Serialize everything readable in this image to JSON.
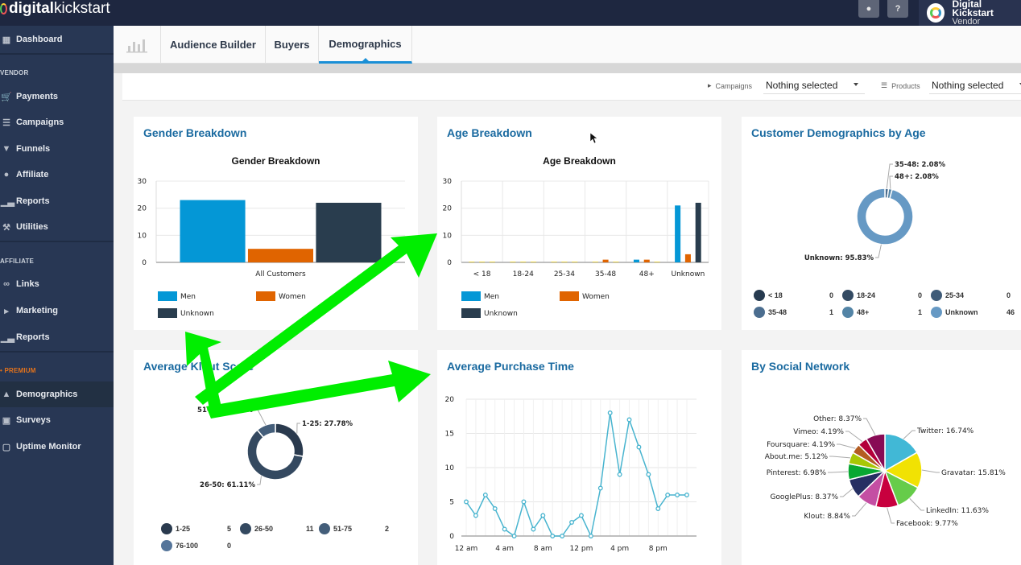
{
  "app": {
    "logo_bold": "digital",
    "logo_light": "kickstart",
    "account_name": "Digital Kickstart",
    "account_role": "Vendor",
    "user_btn_icon": "user-icon",
    "help_btn_label": "?"
  },
  "sidebar": {
    "dashboard": "Dashboard",
    "sections": [
      {
        "title": "VENDOR",
        "items": [
          {
            "label": "Payments",
            "icon": "cart-icon"
          },
          {
            "label": "Campaigns",
            "icon": "list-icon"
          },
          {
            "label": "Funnels",
            "icon": "funnel-icon"
          },
          {
            "label": "Affiliate",
            "icon": "user-icon"
          },
          {
            "label": "Reports",
            "icon": "bar-chart-icon"
          },
          {
            "label": "Utilities",
            "icon": "wrench-icon"
          }
        ]
      },
      {
        "title": "AFFILIATE",
        "items": [
          {
            "label": "Links",
            "icon": "link-icon"
          },
          {
            "label": "Marketing",
            "icon": "megaphone-icon"
          },
          {
            "label": "Reports",
            "icon": "bar-chart-icon"
          }
        ]
      },
      {
        "title": "PREMIUM",
        "items": [
          {
            "label": "Demographics",
            "icon": "area-chart-icon",
            "active": true
          },
          {
            "label": "Surveys",
            "icon": "document-icon"
          },
          {
            "label": "Uptime Monitor",
            "icon": "monitor-icon"
          }
        ]
      }
    ]
  },
  "tabs": [
    {
      "label": "Audience Builder"
    },
    {
      "label": "Buyers"
    },
    {
      "label": "Demographics",
      "active": true
    }
  ],
  "filters": {
    "campaigns_label": "Campaigns",
    "campaigns_value": "Nothing selected",
    "products_label": "Products",
    "products_value": "Nothing selected"
  },
  "cards": {
    "gender": {
      "title": "Gender Breakdown"
    },
    "age": {
      "title": "Age Breakdown"
    },
    "cust_age": {
      "title": "Customer Demographics by Age"
    },
    "klout": {
      "title": "Average Klout Score"
    },
    "purchase": {
      "title": "Average Purchase Time"
    },
    "social": {
      "title": "By Social Network"
    }
  },
  "chart_data": [
    {
      "id": "gender",
      "type": "bar",
      "title": "Gender Breakdown",
      "categories": [
        "All Customers"
      ],
      "series": [
        {
          "name": "Men",
          "values": [
            23
          ],
          "color": "#0497d6"
        },
        {
          "name": "Women",
          "values": [
            5
          ],
          "color": "#e06400"
        },
        {
          "name": "Unknown",
          "values": [
            22
          ],
          "color": "#293d4e"
        }
      ],
      "ylim": [
        0,
        30
      ],
      "yticks": [
        0,
        10,
        20,
        30
      ],
      "legend": "bottom-left"
    },
    {
      "id": "age",
      "type": "bar",
      "title": "Age Breakdown",
      "categories": [
        "< 18",
        "18-24",
        "25-34",
        "35-48",
        "48+",
        "Unknown"
      ],
      "series": [
        {
          "name": "Men",
          "values": [
            0,
            0,
            0,
            0,
            1,
            21
          ],
          "color": "#0497d6"
        },
        {
          "name": "Women",
          "values": [
            0,
            0,
            0,
            1,
            1,
            3
          ],
          "color": "#e06400"
        },
        {
          "name": "Unknown",
          "values": [
            0,
            0,
            0,
            0,
            0,
            22
          ],
          "color": "#293d4e"
        }
      ],
      "ylim": [
        0,
        30
      ],
      "yticks": [
        0,
        10,
        20,
        30
      ],
      "legend": "bottom-left"
    },
    {
      "id": "cust_age",
      "type": "pie",
      "donut": true,
      "slices": [
        {
          "label": "< 18",
          "value": 0,
          "color": "#263a4f"
        },
        {
          "label": "18-24",
          "value": 0,
          "color": "#344b63"
        },
        {
          "label": "25-34",
          "value": 0,
          "color": "#3f5b78"
        },
        {
          "label": "35-48",
          "value": 1,
          "pct": "2.08%",
          "color": "#4b6d8f"
        },
        {
          "label": "48+",
          "value": 1,
          "pct": "2.08%",
          "color": "#5384a6"
        },
        {
          "label": "Unknown",
          "value": 46,
          "pct": "95.83%",
          "color": "#6699c4"
        }
      ]
    },
    {
      "id": "klout",
      "type": "pie",
      "donut": true,
      "slices": [
        {
          "label": "1-25",
          "value": 5,
          "pct": "27.78%",
          "color": "#2a3a4e"
        },
        {
          "label": "26-50",
          "value": 11,
          "pct": "61.11%",
          "color": "#344960"
        },
        {
          "label": "51-75",
          "value": 2,
          "pct": "11.11%",
          "color": "#445e7a"
        },
        {
          "label": "76-100",
          "value": 0,
          "color": "#55759a"
        }
      ]
    },
    {
      "id": "purchase",
      "type": "line",
      "x": [
        "12 am",
        "1 am",
        "2 am",
        "3 am",
        "4 am",
        "5 am",
        "6 am",
        "7 am",
        "8 am",
        "9 am",
        "10 am",
        "11 am",
        "12 pm",
        "1 pm",
        "2 pm",
        "3 pm",
        "4 pm",
        "5 pm",
        "6 pm",
        "7 pm",
        "8 pm",
        "9 pm",
        "10 pm",
        "11 pm"
      ],
      "xticks": [
        "12 am",
        "4 am",
        "8 am",
        "12 pm",
        "4 pm",
        "8 pm"
      ],
      "values": [
        5,
        3,
        6,
        4,
        1,
        0,
        5,
        1,
        3,
        0,
        0,
        2,
        3,
        0,
        7,
        18,
        9,
        17,
        13,
        9,
        4,
        6,
        6,
        6
      ],
      "ylim": [
        0,
        20
      ],
      "yticks": [
        0,
        5,
        10,
        15,
        20
      ],
      "color": "#48b4cf"
    },
    {
      "id": "social",
      "type": "pie",
      "slices": [
        {
          "label": "Twitter",
          "pct": "16.74%",
          "value": 16.74,
          "color": "#41b8d6"
        },
        {
          "label": "Gravatar",
          "pct": "15.81%",
          "value": 15.81,
          "color": "#f1e203"
        },
        {
          "label": "LinkedIn",
          "pct": "11.63%",
          "value": 11.63,
          "color": "#66cc4a"
        },
        {
          "label": "Facebook",
          "pct": "9.77%",
          "value": 9.77,
          "color": "#c8003e"
        },
        {
          "label": "Klout",
          "pct": "8.84%",
          "value": 8.84,
          "color": "#c44ea3"
        },
        {
          "label": "GooglePlus",
          "pct": "8.37%",
          "value": 8.37,
          "color": "#262f63"
        },
        {
          "label": "Pinterest",
          "pct": "6.98%",
          "value": 6.98,
          "color": "#09a832"
        },
        {
          "label": "About.me",
          "pct": "5.12%",
          "value": 5.12,
          "color": "#a8c705"
        },
        {
          "label": "Foursquare",
          "pct": "4.19%",
          "value": 4.19,
          "color": "#b45d22"
        },
        {
          "label": "Vimeo",
          "pct": "4.19%",
          "value": 4.19,
          "color": "#b3003a"
        },
        {
          "label": "Other",
          "pct": "8.37%",
          "value": 8.37,
          "color": "#880b55"
        }
      ]
    }
  ]
}
